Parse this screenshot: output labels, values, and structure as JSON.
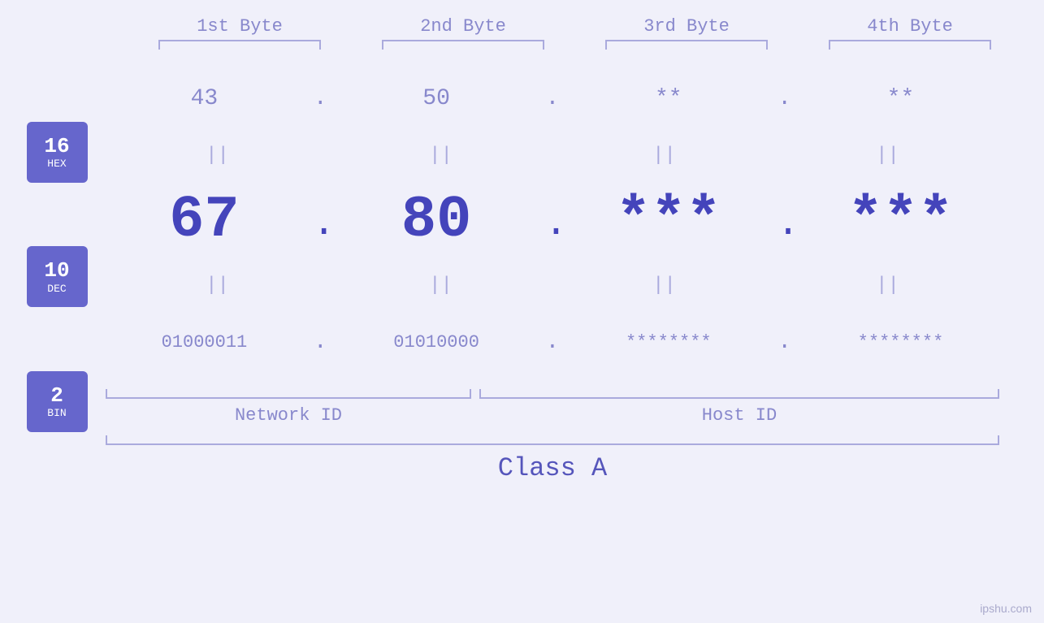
{
  "bytes": {
    "headers": [
      "1st Byte",
      "2nd Byte",
      "3rd Byte",
      "4th Byte"
    ]
  },
  "badges": [
    {
      "number": "16",
      "label": "HEX"
    },
    {
      "number": "10",
      "label": "DEC"
    },
    {
      "number": "2",
      "label": "BIN"
    }
  ],
  "hex_row": {
    "values": [
      "43",
      "50",
      "**",
      "**"
    ],
    "dots": [
      ".",
      ".",
      ".",
      ""
    ]
  },
  "dec_row": {
    "values": [
      "67",
      "80",
      "***",
      "***"
    ],
    "dots": [
      ".",
      ".",
      ".",
      ""
    ]
  },
  "bin_row": {
    "values": [
      "01000011",
      "01010000",
      "********",
      "********"
    ],
    "dots": [
      ".",
      ".",
      ".",
      ""
    ]
  },
  "labels": {
    "network_id": "Network ID",
    "host_id": "Host ID",
    "class": "Class A"
  },
  "watermark": "ipshu.com",
  "separators": [
    "||",
    "||",
    "||",
    "||"
  ]
}
